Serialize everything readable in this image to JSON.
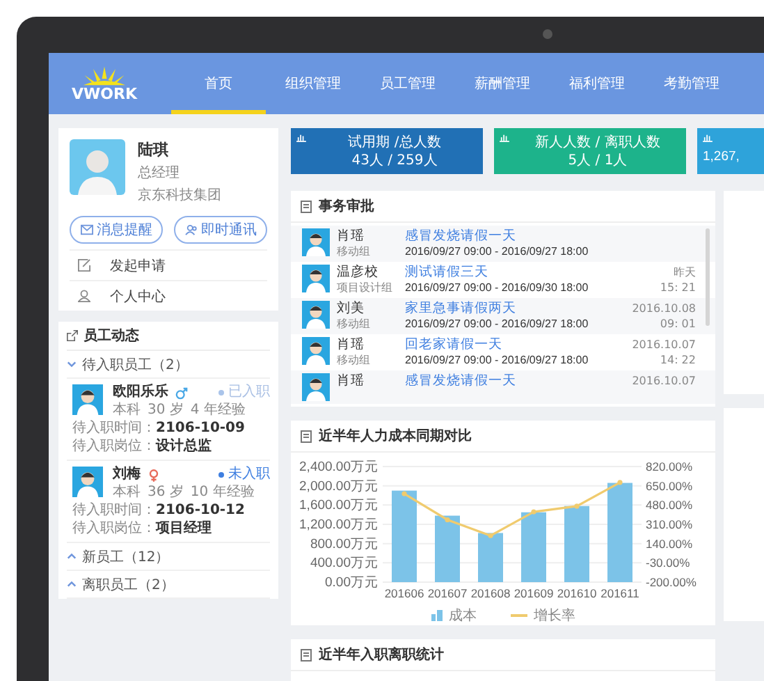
{
  "header": {
    "logo": "VWORK",
    "nav": [
      {
        "label": "首页",
        "selected": true
      },
      {
        "label": "组织管理",
        "selected": false
      },
      {
        "label": "员工管理",
        "selected": false
      },
      {
        "label": "薪酬管理",
        "selected": false
      },
      {
        "label": "福利管理",
        "selected": false
      },
      {
        "label": "考勤管理",
        "selected": false
      }
    ]
  },
  "profile": {
    "name": "陆琪",
    "title": "总经理",
    "company": "京东科技集团",
    "buttons": [
      {
        "label": "消息提醒",
        "kind": "mail"
      },
      {
        "label": "即时通讯",
        "kind": "chat"
      }
    ],
    "menu": [
      {
        "label": "发起申请",
        "kind": "edit"
      },
      {
        "label": "个人中心",
        "kind": "user"
      }
    ]
  },
  "staff_updates": {
    "title": "员工动态",
    "groups": [
      {
        "label": "待入职员工（2）",
        "expanded": true,
        "people": [
          {
            "name": "欧阳乐乐",
            "kind": "male",
            "status": "已入职",
            "joined": true,
            "education": "本科",
            "age": "30 岁",
            "experience": "4 年经验",
            "date_label": "待入职时间：",
            "date": "2106-10-09",
            "post_label": "待入职岗位：",
            "post": "设计总监"
          },
          {
            "name": "刘梅",
            "kind": "female",
            "status": "未入职",
            "joined": false,
            "education": "本科",
            "age": "36 岁",
            "experience": "10 年经验",
            "date_label": "待入职时间：",
            "date": "2106-10-12",
            "post_label": "待入职岗位：",
            "post": "项目经理"
          }
        ]
      },
      {
        "label": "新员工（12）",
        "expanded": false
      },
      {
        "label": "离职员工（2）",
        "expanded": false
      }
    ]
  },
  "stats": [
    {
      "title": "试用期 /总人数",
      "value": "43人 / 259人",
      "color": "#2170b5"
    },
    {
      "title": "新人人数 / 离职人数",
      "value": "5人 / 1人",
      "color": "#1db38b"
    },
    {
      "value": "1,267,",
      "color": "#2ea3da"
    }
  ],
  "approvals": {
    "title": "事务审批",
    "rows": [
      {
        "name": "肖瑶",
        "dept": "移动组",
        "subject": "感冒发烧请假一天",
        "period": "2016/09/27  09:00 - 2016/09/27  18:00"
      },
      {
        "name": "温彦校",
        "dept": "项目设计组",
        "subject": "测试请假三天",
        "period": "2016/09/27  09:00 - 2016/09/30  18:00",
        "date": "昨天",
        "time": "15: 21"
      },
      {
        "name": "刘美",
        "dept": "移动组",
        "subject": "家里急事请假两天",
        "period": "2016/09/27  09:00 - 2016/09/27  18:00",
        "date": "2016.10.08",
        "time": "09: 01"
      },
      {
        "name": "肖瑶",
        "dept": "移动组",
        "subject": "回老家请假一天",
        "period": "2016/09/27  09:00 - 2016/09/27  18:00",
        "date": "2016.10.07",
        "time": "14: 22"
      },
      {
        "name": "肖瑶",
        "subject": "感冒发烧请假一天",
        "date": "2016.10.07"
      }
    ]
  },
  "cost_chart": {
    "title": "近半年人力成本同期对比",
    "chart_data": {
      "type": "bar",
      "categories": [
        "201606",
        "201607",
        "201608",
        "201609",
        "201610",
        "201611"
      ],
      "series": [
        {
          "name": "成本",
          "type": "bar",
          "color": "#7cc3e8",
          "values": [
            1900,
            1380,
            1020,
            1450,
            1580,
            2060
          ]
        },
        {
          "name": "增长率",
          "type": "line",
          "axis": "y2",
          "marker": "circle",
          "color": "#f0cb6e",
          "values": [
            580,
            350,
            210,
            420,
            470,
            680
          ]
        }
      ],
      "stacked": false,
      "grid": true,
      "legend": "bottom",
      "ylim": [
        0,
        2400
      ],
      "yticks": [
        {
          "value": 0,
          "label": "0.00万元"
        },
        {
          "value": 400,
          "label": "400.00万元"
        },
        {
          "value": 800,
          "label": "800.00万元"
        },
        {
          "value": 1200,
          "label": "1,200.00万元"
        },
        {
          "value": 1600,
          "label": "1,600.00万元"
        },
        {
          "value": 2000,
          "label": "2,000.00万元"
        },
        {
          "value": 2400,
          "label": "2,400.00万元"
        }
      ],
      "y2lim": [
        -200,
        820
      ],
      "y2ticks": [
        {
          "value": -200,
          "label": "-200.00%"
        },
        {
          "value": -30,
          "label": "-30.00%"
        },
        {
          "value": 140,
          "label": "140.00%"
        },
        {
          "value": 310,
          "label": "310.00%"
        },
        {
          "value": 480,
          "label": "480.00%"
        },
        {
          "value": 650,
          "label": "650.00%"
        },
        {
          "value": 820,
          "label": "820.00%"
        }
      ]
    }
  },
  "turnover": {
    "title": "近半年入职离职统计"
  }
}
